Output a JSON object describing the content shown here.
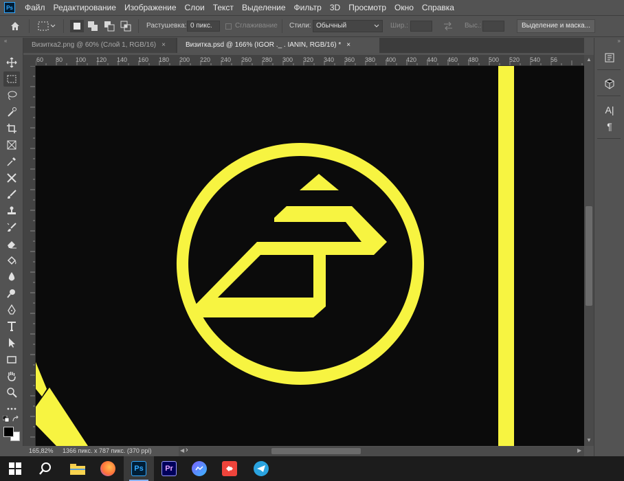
{
  "menubar": {
    "logo": "Ps",
    "items": [
      "Файл",
      "Редактирование",
      "Изображение",
      "Слои",
      "Текст",
      "Выделение",
      "Фильтр",
      "3D",
      "Просмотр",
      "Окно",
      "Справка"
    ]
  },
  "options": {
    "feather_label": "Растушевка:",
    "feather_value": "0 пикс.",
    "antialias_label": "Сглаживание",
    "style_label": "Стили:",
    "style_value": "Обычный",
    "width_label": "Шир.:",
    "height_label": "Выс.:",
    "select_mask_button": "Выделение и маска..."
  },
  "tabs": [
    {
      "label": "Визитка2.png @ 60% (Слой 1, RGB/16)",
      "close": "×",
      "active": false
    },
    {
      "label": "Визитка.psd @ 166% (IGOR ._ . IANIN, RGB/16) *",
      "close": "×",
      "active": true
    }
  ],
  "ruler": {
    "h_labels": [
      "60",
      "80",
      "100",
      "120",
      "140",
      "160",
      "180",
      "200",
      "220",
      "240",
      "260",
      "280",
      "300",
      "320",
      "340",
      "360",
      "380",
      "400",
      "420",
      "440",
      "460",
      "480",
      "500",
      "520",
      "540",
      "56"
    ]
  },
  "status": {
    "zoom": "165,82%",
    "doc_info": "1366 пикс. x 787 пикс. (370 ppi)",
    "arrow": "›"
  },
  "colors": {
    "accent_yellow": "#f7f441",
    "canvas_bg": "#0b0b0b",
    "ui_panel": "#535353",
    "ps_blue": "#31a8ff"
  },
  "toolbar": {
    "tools": [
      "move-icon",
      "marquee-icon",
      "lasso-icon",
      "quick-select-icon",
      "crop-icon",
      "frame-icon",
      "eyedropper-icon",
      "healing-icon",
      "brush-icon",
      "stamp-icon",
      "history-brush-icon",
      "eraser-icon",
      "paint-bucket-icon",
      "blur-icon",
      "dodge-icon",
      "pen-icon",
      "type-icon",
      "path-select-icon",
      "rectangle-icon",
      "hand-icon",
      "zoom-icon",
      "more-icon"
    ]
  },
  "right_panel": {
    "type_label": "A|",
    "paragraph_label": "¶"
  },
  "taskbar": {
    "apps": [
      "windows-start",
      "search",
      "file-explorer",
      "firefox",
      "photoshop",
      "premiere",
      "messenger",
      "anydesk",
      "telegram"
    ],
    "photoshop_label": "Ps",
    "premiere_label": "Pr"
  }
}
